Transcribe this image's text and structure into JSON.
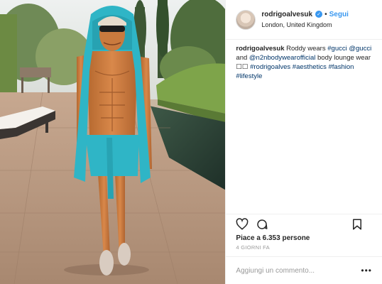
{
  "header": {
    "username": "rodrigoalvesuk",
    "follow_label": "Segui",
    "location": "London, United Kingdom"
  },
  "caption": {
    "username": "rodrigoalvesuk",
    "t1": " Roddy wears ",
    "tag1": "#gucci",
    "mention1": "@gucci",
    "t2": " and ",
    "mention2": "@n2nbodywearofficial",
    "t3": " body lounge wear ☐☐ ",
    "tag2": "#rodrigoalves",
    "tag3": "#aesthetics",
    "tag4": "#fashion",
    "tag5": "#lifestyle"
  },
  "likes_text": "Piace a 6.353 persone",
  "time_ago": "4 GIORNI FA",
  "comment": {
    "placeholder": "Aggiungi un commento...",
    "more": "•••"
  },
  "icons": [
    "heart-icon",
    "comment-icon",
    "bookmark-icon",
    "verified-icon",
    "more-options-icon"
  ],
  "colors": {
    "link_blue": "#3897f0",
    "hashtag": "#003569",
    "text": "#262626",
    "muted": "#999999",
    "outfit_teal": "#2fb5c6"
  }
}
